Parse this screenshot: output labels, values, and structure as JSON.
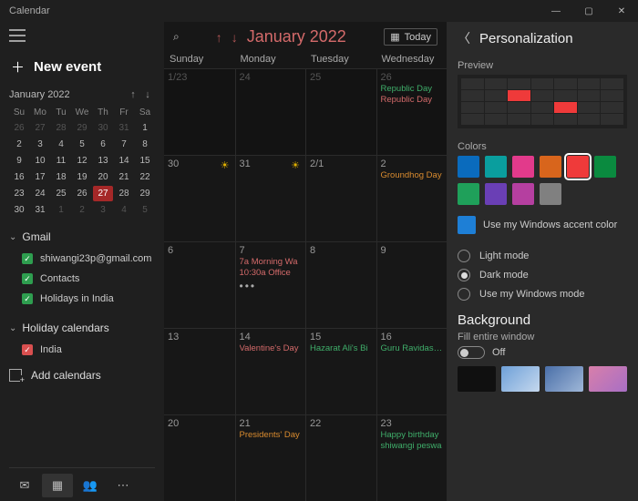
{
  "window": {
    "title": "Calendar",
    "min": "—",
    "max": "▢",
    "close": "✕"
  },
  "sidebar": {
    "newevent": "New event",
    "minical_title": "January 2022",
    "daynames": [
      "Su",
      "Mo",
      "Tu",
      "We",
      "Th",
      "Fr",
      "Sa"
    ],
    "minical": [
      {
        "n": "26",
        "dim": true
      },
      {
        "n": "27",
        "dim": true
      },
      {
        "n": "28",
        "dim": true
      },
      {
        "n": "29",
        "dim": true
      },
      {
        "n": "30",
        "dim": true
      },
      {
        "n": "31",
        "dim": true
      },
      {
        "n": "1"
      },
      {
        "n": "2"
      },
      {
        "n": "3"
      },
      {
        "n": "4"
      },
      {
        "n": "5"
      },
      {
        "n": "6"
      },
      {
        "n": "7"
      },
      {
        "n": "8"
      },
      {
        "n": "9"
      },
      {
        "n": "10"
      },
      {
        "n": "11"
      },
      {
        "n": "12"
      },
      {
        "n": "13"
      },
      {
        "n": "14"
      },
      {
        "n": "15"
      },
      {
        "n": "16"
      },
      {
        "n": "17"
      },
      {
        "n": "18"
      },
      {
        "n": "19"
      },
      {
        "n": "20"
      },
      {
        "n": "21"
      },
      {
        "n": "22"
      },
      {
        "n": "23"
      },
      {
        "n": "24"
      },
      {
        "n": "25"
      },
      {
        "n": "26"
      },
      {
        "n": "27",
        "today": true
      },
      {
        "n": "28"
      },
      {
        "n": "29"
      },
      {
        "n": "30"
      },
      {
        "n": "31"
      },
      {
        "n": "1",
        "dim": true
      },
      {
        "n": "2",
        "dim": true
      },
      {
        "n": "3",
        "dim": true
      },
      {
        "n": "4",
        "dim": true
      },
      {
        "n": "5",
        "dim": true
      }
    ],
    "accounts": [
      {
        "name": "Gmail",
        "items": [
          {
            "label": "shiwangi23p@gmail.com",
            "color": "#2e9e4f"
          },
          {
            "label": "Contacts",
            "color": "#2e9e4f"
          },
          {
            "label": "Holidays in India",
            "color": "#2e9e4f"
          }
        ]
      },
      {
        "name": "Holiday calendars",
        "items": [
          {
            "label": "India",
            "color": "#d94f4f"
          }
        ]
      }
    ],
    "addcalendars": "Add calendars"
  },
  "calendar": {
    "title": "January 2022",
    "today": "Today",
    "dayheaders": [
      "Sunday",
      "Monday",
      "Tuesday",
      "Wednesday"
    ],
    "weeks": [
      [
        {
          "d": "1/23",
          "oom": true
        },
        {
          "d": "24",
          "oom": true
        },
        {
          "d": "25",
          "oom": true
        },
        {
          "d": "26",
          "oom": true,
          "events": [
            {
              "t": "Republic Day",
              "c": "#3fae6a"
            },
            {
              "t": "Republic Day",
              "c": "#d46a6a"
            }
          ]
        }
      ],
      [
        {
          "d": "30",
          "sun": true
        },
        {
          "d": "31",
          "sun": true
        },
        {
          "d": "2/1"
        },
        {
          "d": "2",
          "events": [
            {
              "t": "Groundhog Day",
              "c": "#d98b2f"
            }
          ]
        }
      ],
      [
        {
          "d": "6"
        },
        {
          "d": "7",
          "events": [
            {
              "t": "7a Morning Wa",
              "c": "#d46a6a"
            },
            {
              "t": "10:30a Office",
              "c": "#d46a6a"
            }
          ],
          "dots": true
        },
        {
          "d": "8"
        },
        {
          "d": "9"
        }
      ],
      [
        {
          "d": "13"
        },
        {
          "d": "14",
          "events": [
            {
              "t": "Valentine's Day",
              "c": "#d46a6a"
            }
          ]
        },
        {
          "d": "15",
          "events": [
            {
              "t": "Hazarat Ali's Bi",
              "c": "#3fae6a"
            }
          ]
        },
        {
          "d": "16",
          "events": [
            {
              "t": "Guru Ravidas Ja",
              "c": "#3fae6a"
            }
          ]
        }
      ],
      [
        {
          "d": "20"
        },
        {
          "d": "21",
          "events": [
            {
              "t": "Presidents' Day",
              "c": "#d98b2f"
            }
          ]
        },
        {
          "d": "22"
        },
        {
          "d": "23",
          "events": [
            {
              "t": "Happy birthday",
              "c": "#3fae6a"
            },
            {
              "t": "shiwangi peswa",
              "c": "#3fae6a"
            }
          ]
        }
      ]
    ]
  },
  "panel": {
    "title": "Personalization",
    "preview": "Preview",
    "colors_label": "Colors",
    "colors": [
      {
        "c": "#0a6bbd"
      },
      {
        "c": "#0a9e9e"
      },
      {
        "c": "#e23a8b"
      },
      {
        "c": "#d8651c"
      },
      {
        "c": "#ef3a3a",
        "sel": true
      },
      {
        "c": "#0a8a3f"
      },
      {
        "c": "#1fa05a"
      },
      {
        "c": "#6a3fb5"
      },
      {
        "c": "#b53fa0"
      },
      {
        "c": "#808080"
      }
    ],
    "accent": {
      "c": "#1e7fd6",
      "label": "Use my Windows accent color"
    },
    "modes": [
      {
        "label": "Light mode",
        "on": false
      },
      {
        "label": "Dark mode",
        "on": true
      },
      {
        "label": "Use my Windows mode",
        "on": false
      }
    ],
    "background": "Background",
    "fill_label": "Fill entire window",
    "toggle_state": "Off",
    "thumbs": [
      "#101010",
      "linear-gradient(135deg,#6ea0d8,#c5d8ee)",
      "linear-gradient(135deg,#4a6fa8,#9fb7d8)",
      "linear-gradient(135deg,#d87faa,#a86fc5)"
    ]
  }
}
